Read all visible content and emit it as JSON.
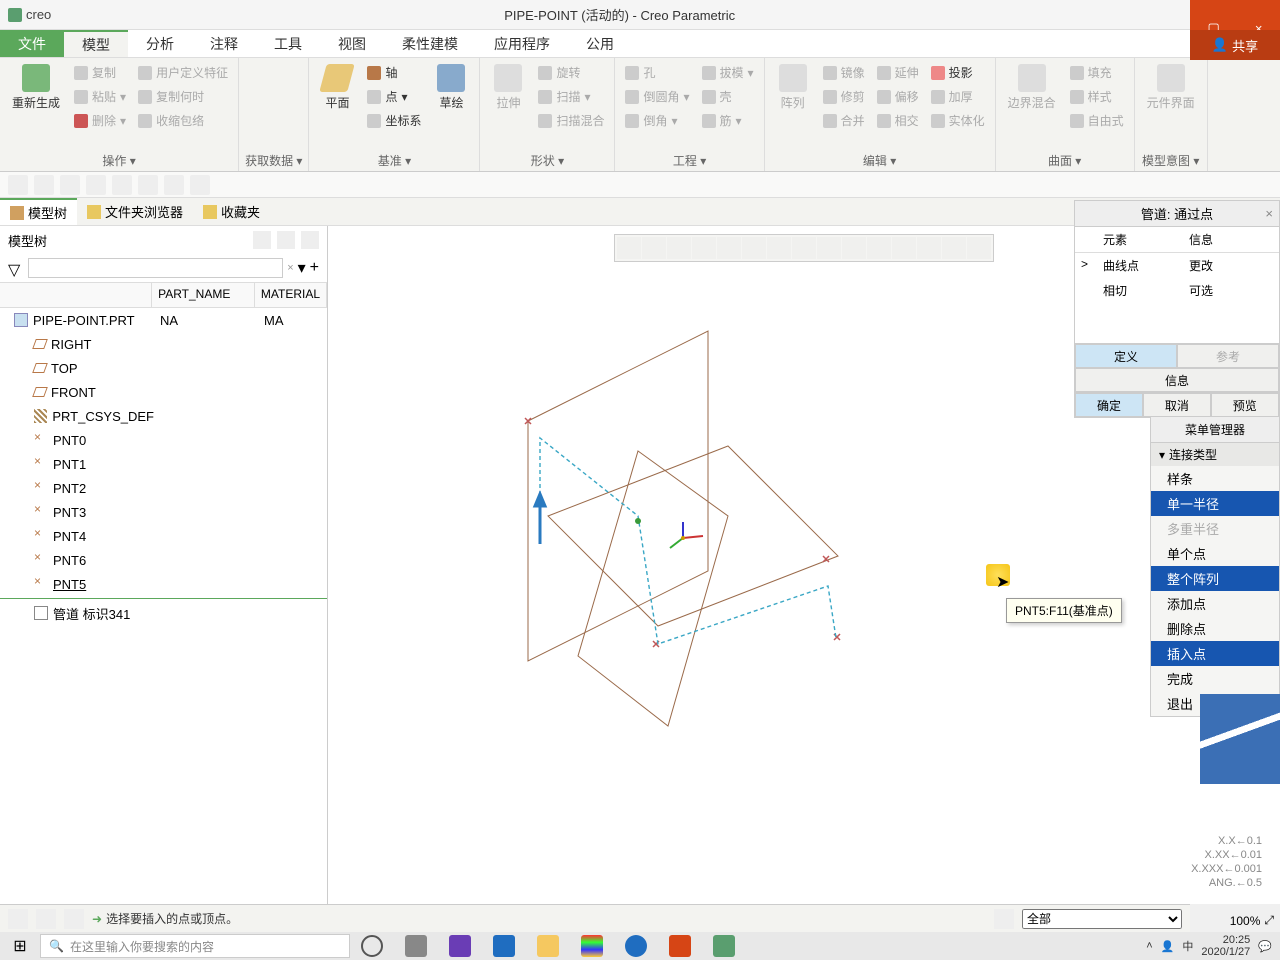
{
  "app": {
    "name": "creo",
    "title": "PIPE-POINT (活动的) - Creo Parametric"
  },
  "ppt": {
    "close": "×",
    "share": "共享"
  },
  "tabs": {
    "file": "文件",
    "items": [
      "模型",
      "分析",
      "注释",
      "工具",
      "视图",
      "柔性建模",
      "应用程序",
      "公用"
    ],
    "active": 0
  },
  "ribbon": {
    "g0": {
      "label": "操作",
      "regen": "重新生成",
      "copy": "复制",
      "paste": "粘贴",
      "delete": "删除",
      "copymany": "复制何时",
      "shrink": "收缩包络",
      "userfeat": "用户定义特征"
    },
    "g1": {
      "label": "获取数据"
    },
    "g2": {
      "label": "基准",
      "plane": "平面",
      "sketch": "草绘",
      "axis": "轴",
      "point": "点",
      "csys": "坐标系"
    },
    "g3": {
      "label": "形状",
      "extrude": "拉伸",
      "revolve": "旋转",
      "sweep": "扫描",
      "blend": "扫描混合"
    },
    "g4": {
      "label": "工程",
      "hole": "孔",
      "chamfer": "倒圆角",
      "round": "倒角",
      "draft": "拔模",
      "shell": "壳",
      "rib": "筋"
    },
    "g5": {
      "label": "编辑",
      "pattern": "阵列",
      "mirror": "镜像",
      "trim": "修剪",
      "merge": "合并",
      "extend": "延伸",
      "offset": "偏移",
      "intersect": "相交",
      "project": "投影",
      "thicken": "加厚",
      "solidify": "实体化"
    },
    "g6": {
      "label": "曲面",
      "boundary": "边界混合",
      "fill": "填充",
      "style": "样式",
      "freestyle": "自由式"
    },
    "g7": {
      "label": "模型意图",
      "compintf": "元件界面"
    }
  },
  "nav": {
    "tabs": [
      "模型树",
      "文件夹浏览器",
      "收藏夹"
    ],
    "active": 0
  },
  "tree": {
    "title": "模型树",
    "cols": {
      "name": "PART_NAME",
      "mat": "MATERIAL"
    },
    "root": {
      "name": "PIPE-POINT.PRT",
      "part": "NA",
      "mat": "MA"
    },
    "planes": [
      "RIGHT",
      "TOP",
      "FRONT"
    ],
    "csys": "PRT_CSYS_DEF",
    "points": [
      "PNT0",
      "PNT1",
      "PNT2",
      "PNT3",
      "PNT4",
      "PNT6",
      "PNT5"
    ],
    "feature": "管道 标识341"
  },
  "tooltip": "PNT5:F11(基准点)",
  "readout": {
    "l1": "X.X←0.1",
    "l2": "X.XX←0.01",
    "l3": "X.XXX←0.001",
    "l4": "ANG.←0.5"
  },
  "pipe_panel": {
    "title": "管道: 通过点",
    "cols": {
      "elem": "元素",
      "info": "信息"
    },
    "rows": [
      {
        "mark": ">",
        "elem": "曲线点",
        "info": "更改"
      },
      {
        "mark": "",
        "elem": "相切",
        "info": "可选"
      }
    ],
    "btns": {
      "define": "定义",
      "ref": "参考",
      "info": "信息",
      "ok": "确定",
      "cancel": "取消",
      "preview": "预览"
    }
  },
  "menu": {
    "header": "菜单管理器",
    "sub": "连接类型",
    "items": [
      {
        "t": "样条",
        "state": ""
      },
      {
        "t": "单一半径",
        "state": "sel"
      },
      {
        "t": "多重半径",
        "state": "dis"
      },
      {
        "t": "单个点",
        "state": ""
      },
      {
        "t": "整个阵列",
        "state": "sel"
      },
      {
        "t": "添加点",
        "state": ""
      },
      {
        "t": "删除点",
        "state": ""
      },
      {
        "t": "插入点",
        "state": "sel"
      },
      {
        "t": "完成",
        "state": ""
      },
      {
        "t": "退出",
        "state": ""
      }
    ]
  },
  "status": {
    "msg": "选择要插入的点或顶点。",
    "filter": "全部",
    "zoom": "100%"
  },
  "taskbar": {
    "search_placeholder": "在这里输入你要搜索的内容",
    "ime": "中",
    "time": "20:25",
    "date": "2020/1/27"
  }
}
